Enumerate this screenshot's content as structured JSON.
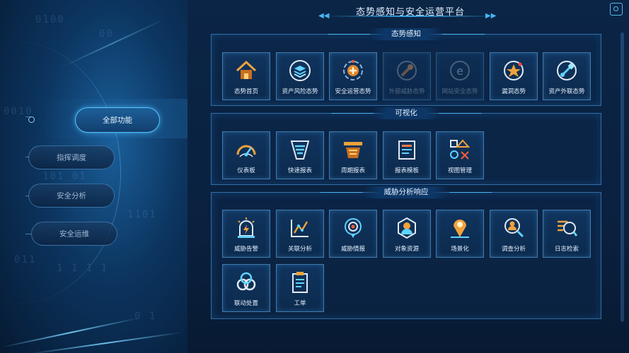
{
  "app": {
    "title": "态势感知与安全运营平台"
  },
  "left_bg_text": [
    "0100",
    "00",
    "0010",
    "1101",
    "101 01",
    "1 1 1 1",
    "011",
    "0 1"
  ],
  "nav": {
    "items": [
      {
        "label": "全部功能",
        "active": true
      },
      {
        "label": "指挥调度",
        "active": false
      },
      {
        "label": "安全分析",
        "active": false
      },
      {
        "label": "安全运维",
        "active": false
      }
    ]
  },
  "sections": [
    {
      "title": "态势感知",
      "tiles": [
        {
          "label": "态势首页",
          "icon": "home-icon",
          "dim": false
        },
        {
          "label": "资产风险态势",
          "icon": "asset-layers-icon",
          "dim": false
        },
        {
          "label": "安全运营态势",
          "icon": "security-ops-icon",
          "dim": false
        },
        {
          "label": "外部威胁态势",
          "icon": "external-threat-icon",
          "dim": true
        },
        {
          "label": "网站安全态势",
          "icon": "website-security-icon",
          "dim": true
        },
        {
          "label": "漏洞态势",
          "icon": "vulnerability-icon",
          "dim": false
        },
        {
          "label": "资产外联态势",
          "icon": "asset-outreach-icon",
          "dim": false
        }
      ]
    },
    {
      "title": "可视化",
      "tiles": [
        {
          "label": "仪表板",
          "icon": "gauge-icon",
          "dim": false
        },
        {
          "label": "快速报表",
          "icon": "quick-report-icon",
          "dim": false
        },
        {
          "label": "周期报表",
          "icon": "periodic-report-icon",
          "dim": false
        },
        {
          "label": "报表模板",
          "icon": "report-template-icon",
          "dim": false
        },
        {
          "label": "视图管理",
          "icon": "view-management-icon",
          "dim": false
        }
      ]
    },
    {
      "title": "威胁分析响应",
      "tiles": [
        {
          "label": "威胁告警",
          "icon": "alarm-icon",
          "dim": false
        },
        {
          "label": "关联分析",
          "icon": "correlation-icon",
          "dim": false
        },
        {
          "label": "威胁情报",
          "icon": "threat-intel-icon",
          "dim": false
        },
        {
          "label": "对象资源",
          "icon": "object-resource-icon",
          "dim": false
        },
        {
          "label": "场景化",
          "icon": "scenario-pin-icon",
          "dim": false
        },
        {
          "label": "调查分析",
          "icon": "investigation-icon",
          "dim": false
        },
        {
          "label": "日志检索",
          "icon": "log-search-icon",
          "dim": false
        },
        {
          "label": "联动处置",
          "icon": "linkage-icon",
          "dim": false
        },
        {
          "label": "工单",
          "icon": "work-order-icon",
          "dim": false
        }
      ]
    }
  ],
  "colors": {
    "accent": "#3aa9ec",
    "orange": "#f0a23a",
    "cyan": "#5fd3ff",
    "bg": "#071a30"
  }
}
